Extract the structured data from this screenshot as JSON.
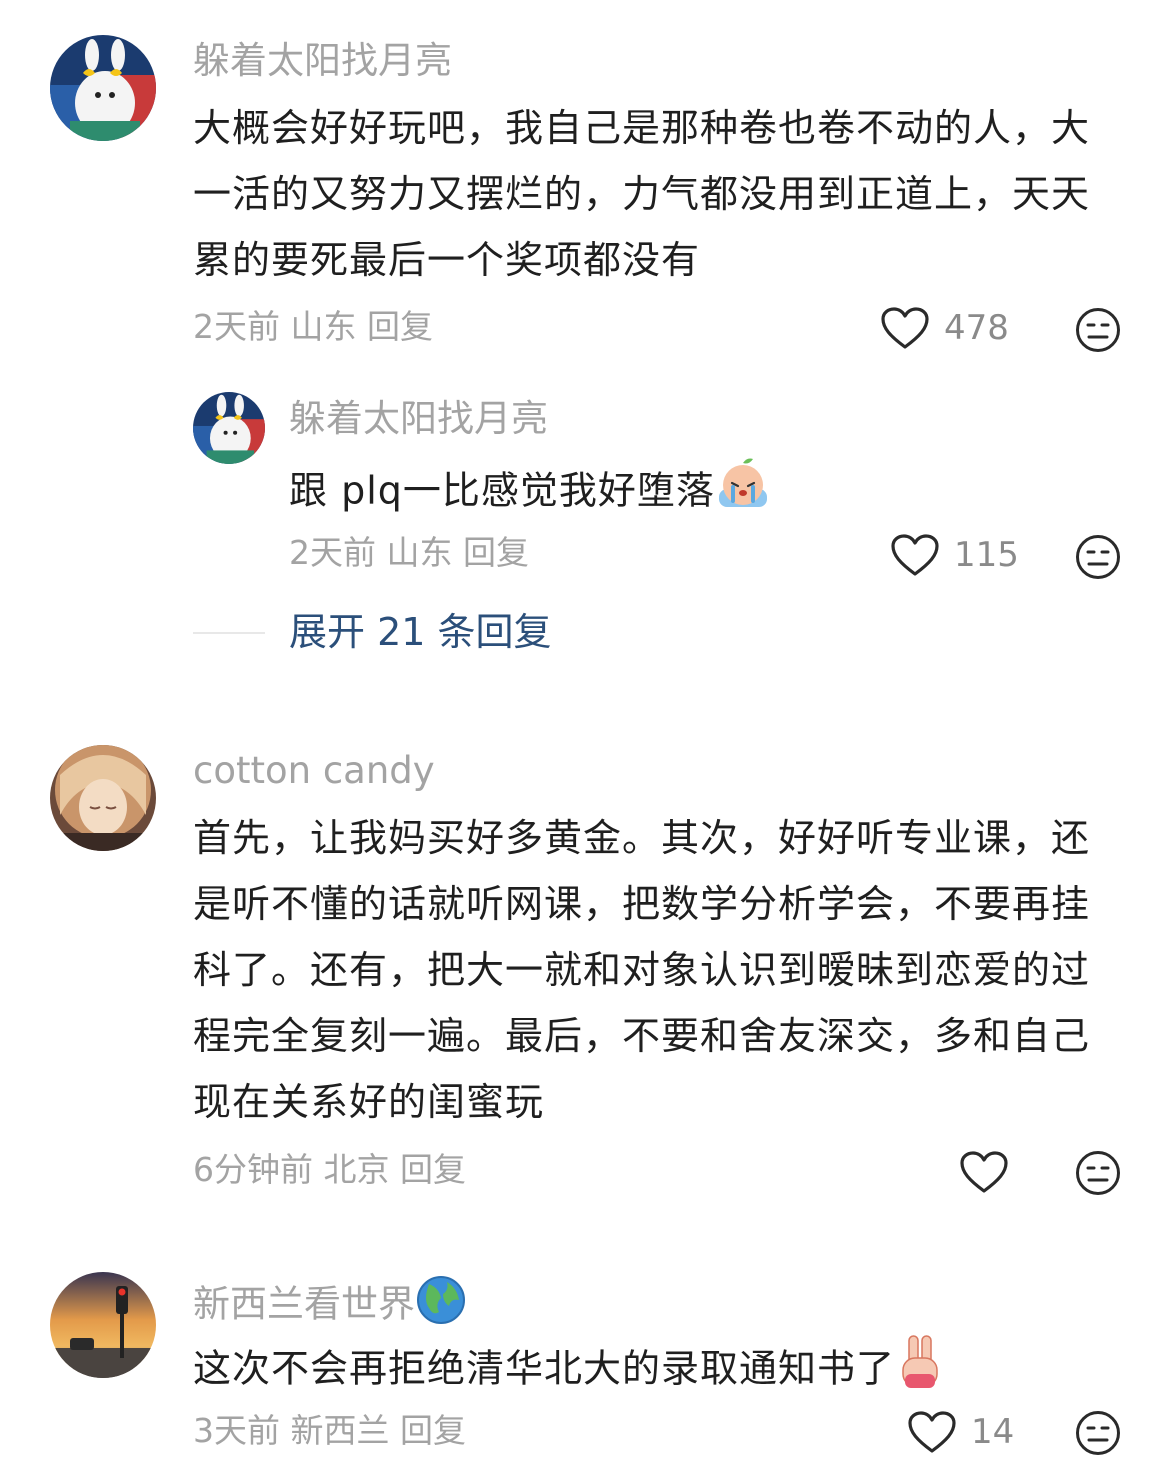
{
  "comments": [
    {
      "username": "躲着太阳找月亮",
      "content": "大概会好好玩吧，我自己是那种卷也卷不动的人，大一活的又努力又摆烂的，力气都没用到正道上，天天累的要死最后一个奖项都没有",
      "time": "2天前",
      "location": "山东",
      "reply_label": "回复",
      "likes": "478",
      "avatar_icon": "bunny-sunglasses-avatar",
      "reply": {
        "username": "躲着太阳找月亮",
        "content": "跟 plq一比感觉我好堕落",
        "emoji_icon": "crying-peach-emoji",
        "time": "2天前",
        "location": "山东",
        "reply_label": "回复",
        "likes": "115"
      },
      "expand_label": "展开 21 条回复"
    },
    {
      "username": "cotton candy",
      "content": "首先，让我妈买好多黄金。其次，好好听专业课，还是听不懂的话就听网课，把数学分析学会，不要再挂科了。还有，把大一就和对象认识到暧昧到恋爱的过程完全复刻一遍。最后，不要和舍友深交，多和自己现在关系好的闺蜜玩",
      "time": "6分钟前",
      "location": "北京",
      "reply_label": "回复",
      "likes": "",
      "avatar_icon": "anime-girl-avatar"
    },
    {
      "username": "新西兰看世界",
      "username_emoji": "globe-icon",
      "content": "这次不会再拒绝清华北大的录取通知书了",
      "emoji_icon": "victory-hand-emoji",
      "time": "3天前",
      "location": "新西兰",
      "reply_label": "回复",
      "likes": "14",
      "avatar_icon": "sunset-traffic-light-avatar"
    }
  ],
  "icons": {
    "like": "heart-outline-icon",
    "dislike": "neutral-face-icon"
  },
  "colors": {
    "meta": "#a3a3a3",
    "text": "#1f1f1f",
    "link": "#2b4f7a",
    "background": "#ffffff"
  }
}
